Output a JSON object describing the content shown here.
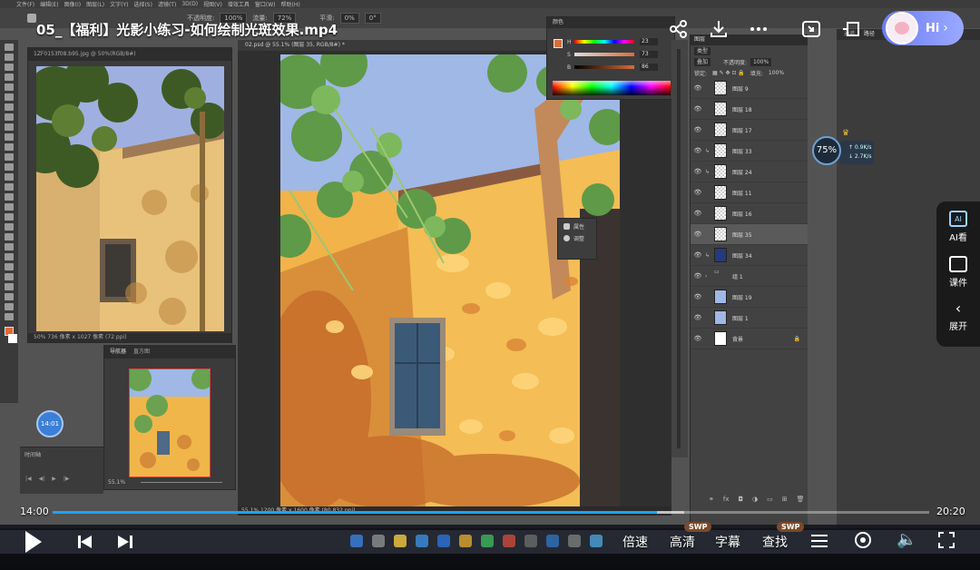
{
  "video": {
    "title": "05_【福利】光影小练习-如何绘制光斑效果.mp4",
    "current_time": "14:00",
    "total_time": "20:20",
    "progress_fraction": 0.689,
    "buffered_fraction": 0.72
  },
  "overlay": {
    "hi_label": "Hi",
    "timer_badge": "14:01",
    "network_percent": "75%",
    "net_up": "↑ 0.9K/s",
    "net_down": "↓ 2.7K/s"
  },
  "side_panel": {
    "items": [
      {
        "label": "AI看",
        "icon": "ai-view-icon"
      },
      {
        "label": "课件",
        "icon": "courseware-icon"
      },
      {
        "label": "展开",
        "icon": "expand-icon"
      }
    ]
  },
  "controls": {
    "speed": "倍速",
    "quality": "高清",
    "subtitle": "字幕",
    "search": "查找",
    "quality_badge": "SWP",
    "search_badge": "SWP"
  },
  "photoshop": {
    "menu": [
      "文件(F)",
      "编辑(E)",
      "图像(I)",
      "图层(L)",
      "文字(Y)",
      "选择(S)",
      "滤镜(T)",
      "3D(D)",
      "视图(V)",
      "增效工具",
      "窗口(W)",
      "帮助(H)"
    ],
    "options": {
      "mode_label": "不透明度:",
      "opacity": "100%",
      "flow_label": "流量:",
      "flow": "72%",
      "smooth_label": "平滑:",
      "smooth": "0%",
      "angle": "0°"
    },
    "ref_window": {
      "tab": "1ZF0153f08.b95.jpg @ 50%(RGB/8#)",
      "status": "50%    736 像素 x 1027 像素 (72 ppi)"
    },
    "doc_window": {
      "tab": "02.psd @ 55.1% (图层 35, RGB/8#) *",
      "status": "55.1%   1200 像素 x 1600 像素 (80.832 ppi)"
    },
    "navigator": {
      "tabs": [
        "导航器",
        "直方图"
      ],
      "zoom": "55.1%"
    },
    "timeline": {
      "label": "时间轴"
    },
    "color_panel": {
      "title": "颜色",
      "channels": [
        {
          "label": "H",
          "value": "23",
          "unit": "°"
        },
        {
          "label": "S",
          "value": "73",
          "unit": "%"
        },
        {
          "label": "B",
          "value": "86",
          "unit": "%"
        }
      ],
      "foreground": "#d96c3a"
    },
    "properties": {
      "items": [
        "属性",
        "调整"
      ]
    },
    "layers": {
      "title": "图层",
      "filter": "类型",
      "blend_mode": "叠加",
      "opacity_label": "不透明度:",
      "opacity": "100%",
      "lock_label": "锁定:",
      "fill_label": "填充:",
      "fill": "100%",
      "list": [
        {
          "name": "图层 9",
          "thumb": "transparent",
          "clip": false,
          "selected": false
        },
        {
          "name": "图层 18",
          "thumb": "transparent",
          "clip": false,
          "selected": false
        },
        {
          "name": "图层 17",
          "thumb": "transparent",
          "clip": false,
          "selected": false
        },
        {
          "name": "图层 33",
          "thumb": "transparent",
          "clip": true,
          "selected": false
        },
        {
          "name": "图层 24",
          "thumb": "transparent",
          "clip": true,
          "selected": false
        },
        {
          "name": "图层 11",
          "thumb": "transparent",
          "clip": false,
          "selected": false
        },
        {
          "name": "图层 16",
          "thumb": "transparent",
          "clip": false,
          "selected": false
        },
        {
          "name": "图层 35",
          "thumb": "transparent",
          "clip": false,
          "selected": true
        },
        {
          "name": "图层 34",
          "thumb": "navy",
          "clip": true,
          "selected": false
        },
        {
          "name": "组 1",
          "thumb": "folder",
          "clip": false,
          "selected": false
        },
        {
          "name": "图层 19",
          "thumb": "blue",
          "clip": false,
          "selected": false
        },
        {
          "name": "图层 1",
          "thumb": "blue",
          "clip": false,
          "selected": false
        },
        {
          "name": "背景",
          "thumb": "white",
          "clip": false,
          "selected": false
        }
      ]
    },
    "right_tabs": [
      "通道",
      "路径"
    ]
  },
  "colors": {
    "accent": "#1aa3ff",
    "wall": "#f2b34a",
    "shadow": "#b9722f",
    "leaf": "#6aa24f",
    "sky": "#9fb8e6"
  }
}
